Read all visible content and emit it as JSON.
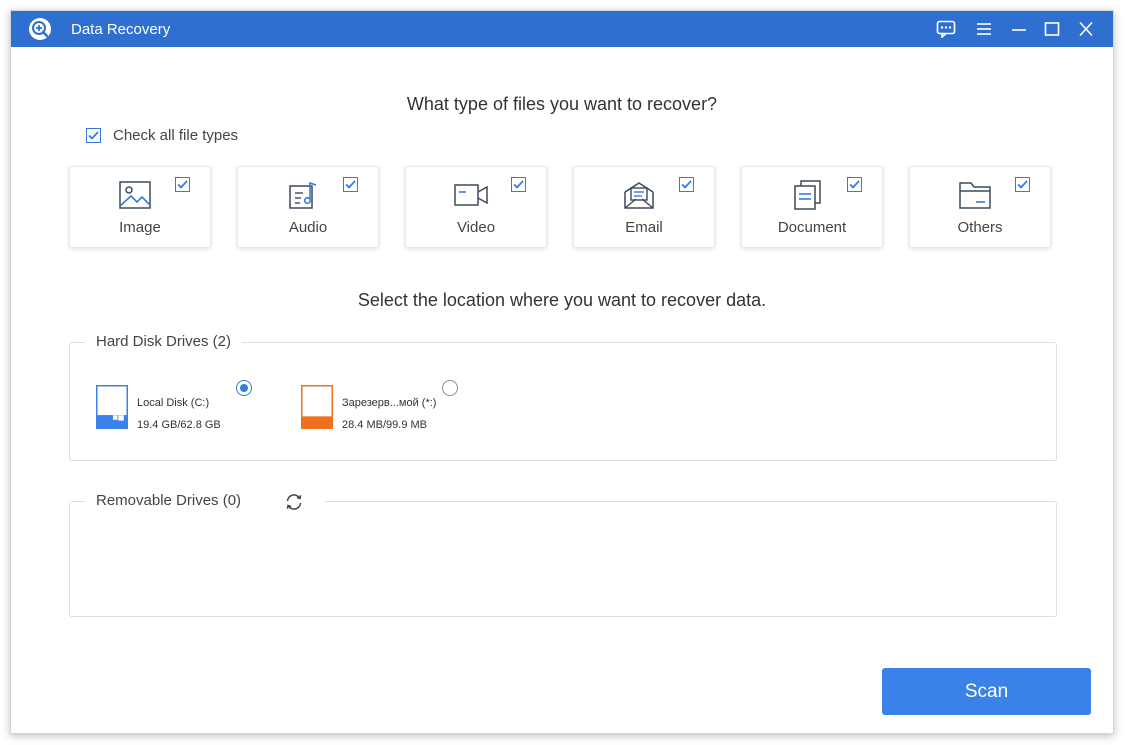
{
  "window": {
    "title": "Data Recovery",
    "accent": "#2f6fd0"
  },
  "controls": {
    "icons": [
      "feedback-icon",
      "menu-icon",
      "minimize-icon",
      "maximize-icon",
      "close-icon"
    ]
  },
  "file_types": {
    "heading": "What type of files you want to recover?",
    "check_all_label": "Check all file types",
    "check_all_checked": true,
    "items": [
      {
        "label": "Image",
        "icon": "image-icon",
        "checked": true
      },
      {
        "label": "Audio",
        "icon": "audio-icon",
        "checked": true
      },
      {
        "label": "Video",
        "icon": "video-icon",
        "checked": true
      },
      {
        "label": "Email",
        "icon": "email-icon",
        "checked": true
      },
      {
        "label": "Document",
        "icon": "document-icon",
        "checked": true
      },
      {
        "label": "Others",
        "icon": "folder-icon",
        "checked": true
      }
    ]
  },
  "location": {
    "heading": "Select the location where you want to recover data.",
    "hard_disks": {
      "legend": "Hard Disk Drives (2)",
      "drives": [
        {
          "name": "Local Disk (C:)",
          "size": "19.4 GB/62.8 GB",
          "used_fraction": 0.31,
          "color": "#3b82e8",
          "selected": true
        },
        {
          "name": "Зарезерв...мой (*:)",
          "size": "28.4 MB/99.9 MB",
          "used_fraction": 0.28,
          "color": "#f07020",
          "selected": false
        }
      ]
    },
    "removable": {
      "legend": "Removable Drives (0)"
    }
  },
  "actions": {
    "scan_label": "Scan",
    "scan_color": "#3b82e8"
  }
}
